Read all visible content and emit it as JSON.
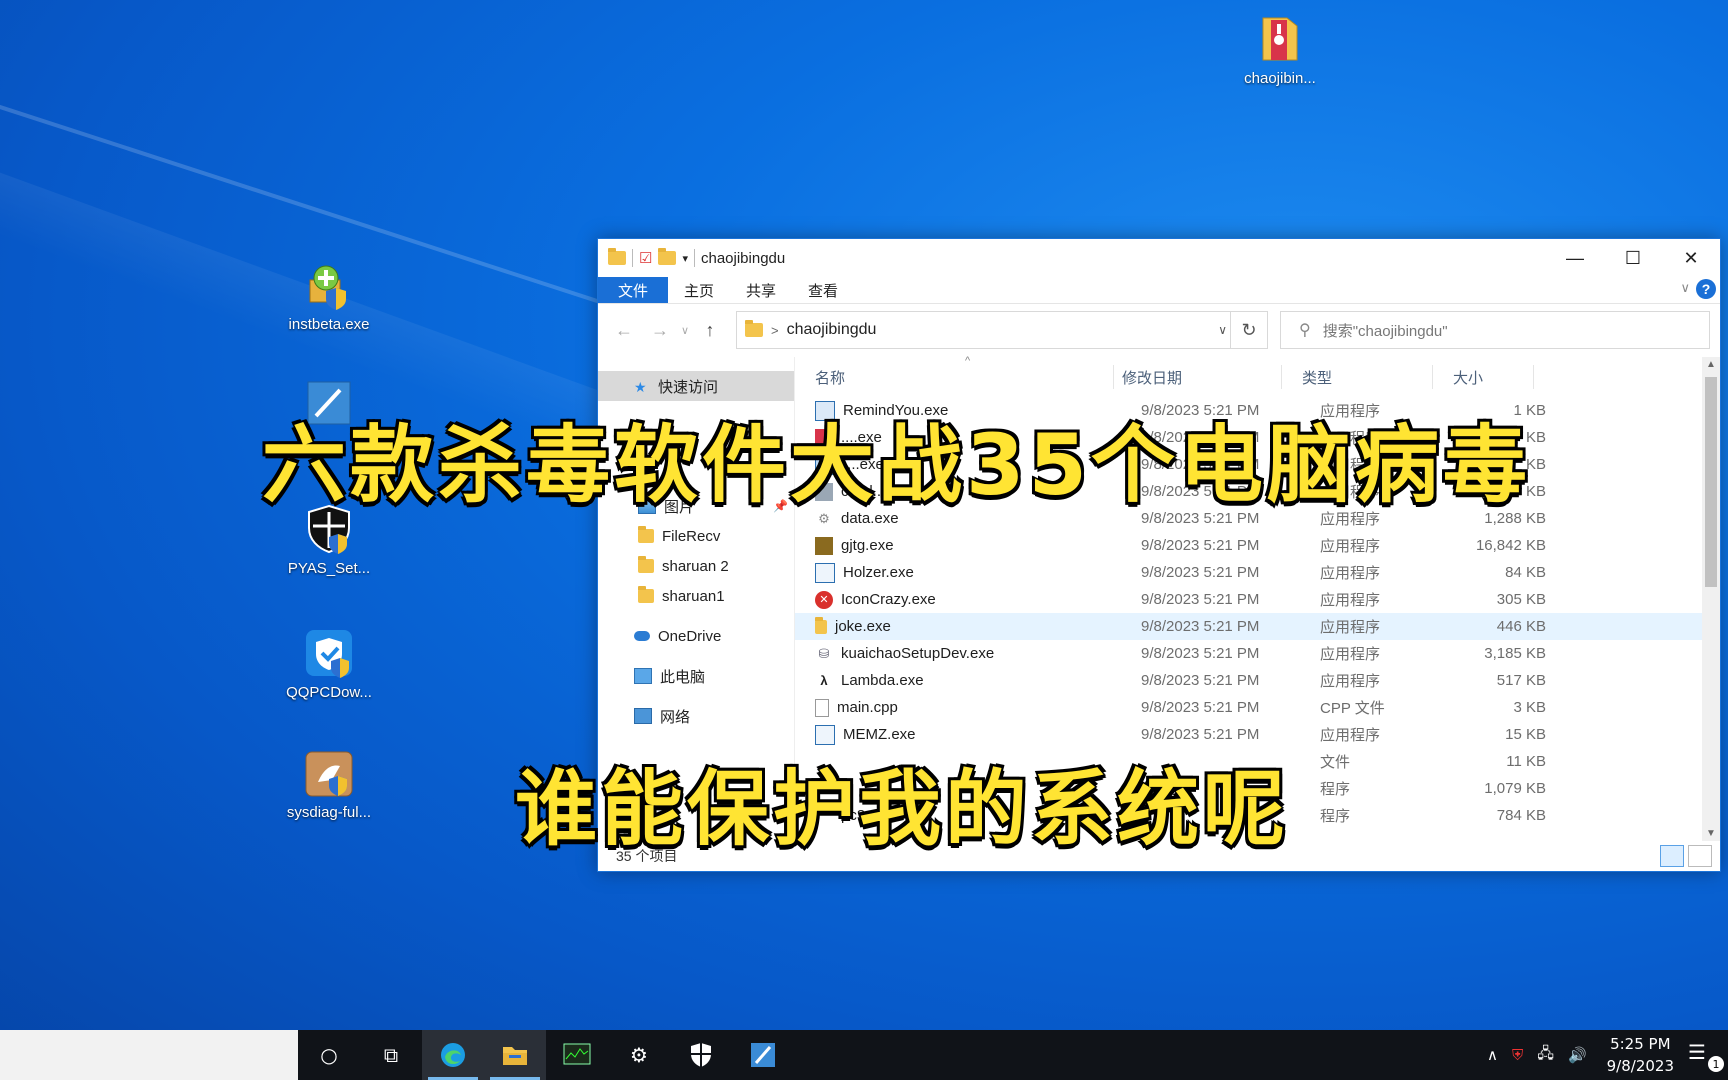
{
  "desktop": {
    "icons": [
      {
        "label": "instbeta.exe"
      },
      {
        "label": "PYAS_Set..."
      },
      {
        "label": "QQPCDow..."
      },
      {
        "label": "sysdiag-ful..."
      },
      {
        "label": "chaojibin..."
      }
    ]
  },
  "explorer": {
    "title": "chaojibingdu",
    "ribbon_tabs": [
      "文件",
      "主页",
      "共享",
      "查看"
    ],
    "help_label": "?",
    "address": "chaojibingdu",
    "search_placeholder": "搜索\"chaojibingdu\"",
    "nav": [
      {
        "label": "快速访问",
        "icon": "star-icon"
      },
      {
        "label": "图片",
        "icon": "pictures-icon"
      },
      {
        "label": "FileRecv",
        "icon": "folder-icon"
      },
      {
        "label": "sharuan 2",
        "icon": "folder-icon"
      },
      {
        "label": "sharuan1",
        "icon": "folder-icon"
      },
      {
        "label": "OneDrive",
        "icon": "cloud-icon"
      },
      {
        "label": "此电脑",
        "icon": "computer-icon"
      },
      {
        "label": "网络",
        "icon": "network-icon"
      }
    ],
    "columns": {
      "name": "名称",
      "date": "修改日期",
      "type": "类型",
      "size": "大小"
    },
    "files": [
      {
        "name": "RemindYou.exe",
        "date": "9/8/2023 5:21 PM",
        "type": "应用程序",
        "size": "1 KB"
      },
      {
        "name": "....exe",
        "date": "9/8/2023 5:21 PM",
        "type": "应用程序",
        "size": "KB"
      },
      {
        "name": "....exe",
        "date": "9/8/2023 5:21 PM",
        "type": "应用程序",
        "size": "KB"
      },
      {
        "name": "czbd...",
        "date": "9/8/2023 5:21 PM",
        "type": "应用程序",
        "size": "KB"
      },
      {
        "name": "data.exe",
        "date": "9/8/2023 5:21 PM",
        "type": "应用程序",
        "size": "1,288 KB"
      },
      {
        "name": "gjtg.exe",
        "date": "9/8/2023 5:21 PM",
        "type": "应用程序",
        "size": "16,842 KB"
      },
      {
        "name": "Holzer.exe",
        "date": "9/8/2023 5:21 PM",
        "type": "应用程序",
        "size": "84 KB"
      },
      {
        "name": "IconCrazy.exe",
        "date": "9/8/2023 5:21 PM",
        "type": "应用程序",
        "size": "305 KB"
      },
      {
        "name": "joke.exe",
        "date": "9/8/2023 5:21 PM",
        "type": "应用程序",
        "size": "446 KB"
      },
      {
        "name": "kuaichaoSetupDev.exe",
        "date": "9/8/2023 5:21 PM",
        "type": "应用程序",
        "size": "3,185 KB"
      },
      {
        "name": "Lambda.exe",
        "date": "9/8/2023 5:21 PM",
        "type": "应用程序",
        "size": "517 KB"
      },
      {
        "name": "main.cpp",
        "date": "9/8/2023 5:21 PM",
        "type": "CPP 文件",
        "size": "3 KB"
      },
      {
        "name": "MEMZ.exe",
        "date": "9/8/2023 5:21 PM",
        "type": "应用程序",
        "size": "15 KB"
      },
      {
        "name": "",
        "date": "",
        "type": "文件",
        "size": "11 KB"
      },
      {
        "name": "",
        "date": "",
        "type": "程序",
        "size": "1,079 KB"
      },
      {
        "name": "pc3.exe",
        "date": "",
        "type": "程序",
        "size": "784 KB"
      }
    ],
    "status": "35 个项目"
  },
  "captions": {
    "line1": "六款杀毒软件大战35个电脑病毒",
    "line2": "谁能保护我的系统呢"
  },
  "taskbar": {
    "time": "5:25 PM",
    "date": "9/8/2023",
    "notification_count": "1"
  }
}
